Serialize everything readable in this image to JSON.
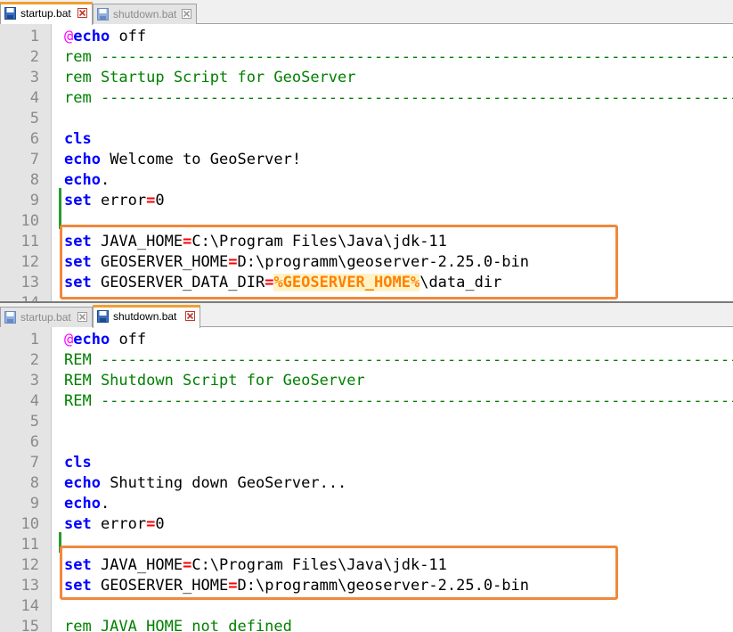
{
  "top_pane": {
    "tabs": [
      {
        "label": "startup.bat",
        "active": true
      },
      {
        "label": "shutdown.bat",
        "active": false
      }
    ],
    "lines": [
      {
        "num": "1",
        "tokens": [
          {
            "t": "@",
            "c": "at"
          },
          {
            "t": "echo",
            "c": "kw"
          },
          {
            "t": " off",
            "c": ""
          }
        ]
      },
      {
        "num": "2",
        "tokens": [
          {
            "t": "rem ---------------------------------------------------------------------------------------------------",
            "c": "cmt"
          }
        ]
      },
      {
        "num": "3",
        "tokens": [
          {
            "t": "rem Startup Script for GeoServer",
            "c": "cmt"
          }
        ]
      },
      {
        "num": "4",
        "tokens": [
          {
            "t": "rem ---------------------------------------------------------------------------------------------------",
            "c": "cmt"
          }
        ]
      },
      {
        "num": "5",
        "tokens": []
      },
      {
        "num": "6",
        "tokens": [
          {
            "t": "cls",
            "c": "kw"
          }
        ]
      },
      {
        "num": "7",
        "tokens": [
          {
            "t": "echo",
            "c": "kw"
          },
          {
            "t": " Welcome to GeoServer!",
            "c": ""
          }
        ]
      },
      {
        "num": "8",
        "tokens": [
          {
            "t": "echo",
            "c": "kw"
          },
          {
            "t": ".",
            "c": ""
          }
        ]
      },
      {
        "num": "9",
        "tokens": [
          {
            "t": "set",
            "c": "kw"
          },
          {
            "t": " error",
            "c": ""
          },
          {
            "t": "=",
            "c": "op"
          },
          {
            "t": "0",
            "c": ""
          }
        ]
      },
      {
        "num": "10",
        "tokens": []
      },
      {
        "num": "11",
        "tokens": [
          {
            "t": "set",
            "c": "kw"
          },
          {
            "t": " JAVA_HOME",
            "c": ""
          },
          {
            "t": "=",
            "c": "op"
          },
          {
            "t": "C:\\Program Files\\Java\\jdk-11",
            "c": ""
          }
        ]
      },
      {
        "num": "12",
        "tokens": [
          {
            "t": "set",
            "c": "kw"
          },
          {
            "t": " GEOSERVER_HOME",
            "c": ""
          },
          {
            "t": "=",
            "c": "op"
          },
          {
            "t": "D:\\programm\\geoserver-2.25.0-bin",
            "c": ""
          }
        ]
      },
      {
        "num": "13",
        "tokens": [
          {
            "t": "set",
            "c": "kw"
          },
          {
            "t": " GEOSERVER_DATA_DIR",
            "c": ""
          },
          {
            "t": "=",
            "c": "op"
          },
          {
            "t": "%GEOSERVER_HOME%",
            "c": "var"
          },
          {
            "t": "\\data_dir",
            "c": ""
          }
        ]
      },
      {
        "num": "14",
        "tokens": []
      }
    ]
  },
  "bottom_pane": {
    "tabs": [
      {
        "label": "startup.bat",
        "active": false
      },
      {
        "label": "shutdown.bat",
        "active": true
      }
    ],
    "lines": [
      {
        "num": "1",
        "tokens": [
          {
            "t": "@",
            "c": "at"
          },
          {
            "t": "echo",
            "c": "kw"
          },
          {
            "t": " off",
            "c": ""
          }
        ]
      },
      {
        "num": "2",
        "tokens": [
          {
            "t": "REM ---------------------------------------------------------------------------------------------------",
            "c": "cmt"
          }
        ]
      },
      {
        "num": "3",
        "tokens": [
          {
            "t": "REM Shutdown Script for GeoServer",
            "c": "cmt"
          }
        ]
      },
      {
        "num": "4",
        "tokens": [
          {
            "t": "REM ---------------------------------------------------------------------------------------------------",
            "c": "cmt"
          }
        ]
      },
      {
        "num": "5",
        "tokens": []
      },
      {
        "num": "6",
        "tokens": []
      },
      {
        "num": "7",
        "tokens": [
          {
            "t": "cls",
            "c": "kw"
          }
        ]
      },
      {
        "num": "8",
        "tokens": [
          {
            "t": "echo",
            "c": "kw"
          },
          {
            "t": " Shutting down GeoServer...",
            "c": ""
          }
        ]
      },
      {
        "num": "9",
        "tokens": [
          {
            "t": "echo",
            "c": "kw"
          },
          {
            "t": ".",
            "c": ""
          }
        ]
      },
      {
        "num": "10",
        "tokens": [
          {
            "t": "set",
            "c": "kw"
          },
          {
            "t": " error",
            "c": ""
          },
          {
            "t": "=",
            "c": "op"
          },
          {
            "t": "0",
            "c": ""
          }
        ]
      },
      {
        "num": "11",
        "tokens": []
      },
      {
        "num": "12",
        "tokens": [
          {
            "t": "set",
            "c": "kw"
          },
          {
            "t": " JAVA_HOME",
            "c": ""
          },
          {
            "t": "=",
            "c": "op"
          },
          {
            "t": "C:\\Program Files\\Java\\jdk-11",
            "c": ""
          }
        ]
      },
      {
        "num": "13",
        "tokens": [
          {
            "t": "set",
            "c": "kw"
          },
          {
            "t": " GEOSERVER_HOME",
            "c": ""
          },
          {
            "t": "=",
            "c": "op"
          },
          {
            "t": "D:\\programm\\geoserver-2.25.0-bin",
            "c": ""
          }
        ]
      },
      {
        "num": "14",
        "tokens": []
      },
      {
        "num": "15",
        "tokens": [
          {
            "t": "rem JAVA_HOME not defined",
            "c": "cmt"
          }
        ]
      }
    ]
  },
  "colors": {
    "keyword": "#0000ff",
    "comment": "#008000",
    "operator": "#ff0000",
    "variable": "#ff8000",
    "at_sign": "#ff00ff",
    "highlight_box": "#f0883c",
    "active_tab_accent": "#f0a030",
    "change_marker": "#2a9a2a"
  },
  "icons": {
    "file": "save-disk-icon",
    "close": "close-x-icon"
  }
}
